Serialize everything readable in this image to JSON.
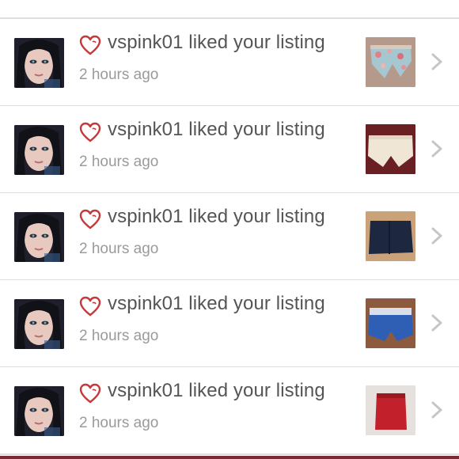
{
  "notifications": [
    {
      "username": "vspink01",
      "action": "liked your listing",
      "message": "vspink01 liked your listing",
      "time": "2 hours ago",
      "item_icon": "denim-shorts-floral-thumbnail"
    },
    {
      "username": "vspink01",
      "action": "liked your listing",
      "message": "vspink01 liked your listing",
      "time": "2 hours ago",
      "item_icon": "white-shorts-thumbnail"
    },
    {
      "username": "vspink01",
      "action": "liked your listing",
      "message": "vspink01 liked your listing",
      "time": "2 hours ago",
      "item_icon": "navy-skort-thumbnail"
    },
    {
      "username": "vspink01",
      "action": "liked your listing",
      "message": "vspink01 liked your listing",
      "time": "2 hours ago",
      "item_icon": "blue-shorts-thumbnail"
    },
    {
      "username": "vspink01",
      "action": "liked your listing",
      "message": "vspink01 liked your listing",
      "time": "2 hours ago",
      "item_icon": "red-top-thumbnail"
    }
  ],
  "colors": {
    "heart": "#c43a3a",
    "message_text": "#555555",
    "time_text": "#9a9a9a",
    "divider": "#dedede",
    "chevron": "#c6c6c6",
    "bottom_bar": "#7a2a35"
  }
}
